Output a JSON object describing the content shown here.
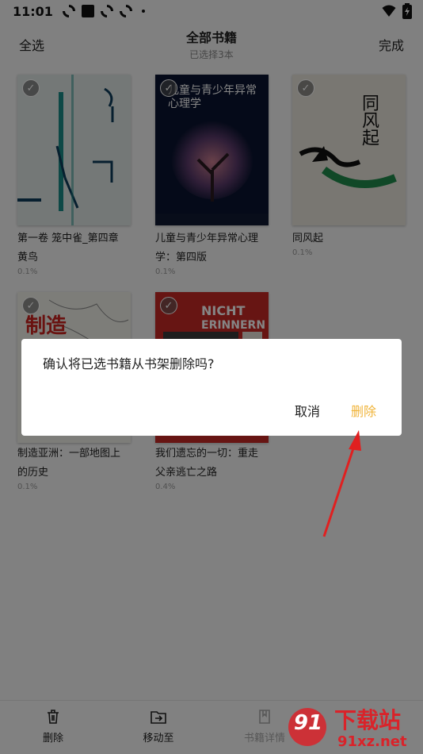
{
  "status_bar": {
    "time": "11:01"
  },
  "header": {
    "select_all": "全选",
    "title": "全部书籍",
    "subtitle": "已选择3本",
    "done": "完成"
  },
  "books": [
    {
      "title_line1": "第一卷 笼中雀_第四章",
      "title_line2": "黄鸟",
      "progress": "0.1%",
      "selected": true
    },
    {
      "title_line1": "儿童与青少年异常心理",
      "title_line2": "学：第四版",
      "progress": "0.1%",
      "selected": true,
      "cover_text": "儿童与青少年异常心理学"
    },
    {
      "title_line1": "同风起",
      "title_line2": "",
      "progress": "0.1%",
      "selected": true,
      "cover_text": "同风起"
    },
    {
      "title_line1": "制造亚洲：一部地图上",
      "title_line2": "的历史",
      "progress": "0.1%",
      "selected": false,
      "cover_text": "制造"
    },
    {
      "title_line1": "我们遗忘的一切：重走",
      "title_line2": "父亲逃亡之路",
      "progress": "0.4%",
      "selected": false,
      "cover_text_line1": "NICHT",
      "cover_text_line2": "ERINNERN"
    }
  ],
  "dialog": {
    "message": "确认将已选书籍从书架删除吗?",
    "cancel": "取消",
    "delete": "删除"
  },
  "toolbar": {
    "delete": "删除",
    "move_to": "移动至",
    "book_details": "书籍详情"
  },
  "watermark": {
    "brand": "下载站",
    "url": "91xz.net",
    "logo_number": "91"
  },
  "colors": {
    "accent": "#f0b43a",
    "arrow": "#e02020",
    "watermark": "#d9232a"
  }
}
